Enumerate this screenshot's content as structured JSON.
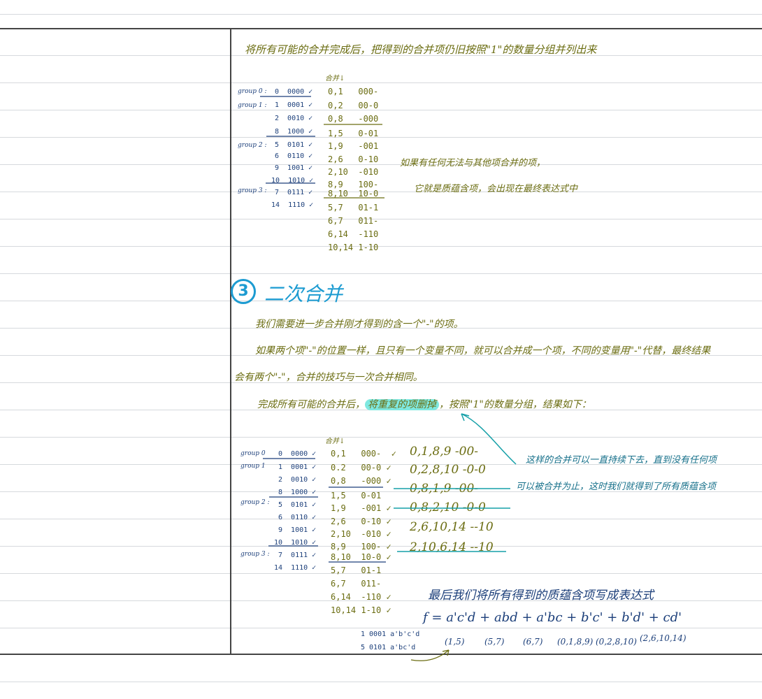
{
  "section1": {
    "intro": "将所有可能的合并完成后，把得到的合并项仍旧按照\"1\"的数量分组并列出来",
    "table_header": "合并↓",
    "group_labels": [
      "group 0 :",
      "group 1 :",
      "group 2 :",
      "group 3 :"
    ],
    "minterms": [
      "0  0000 ✓",
      "1  0001 ✓",
      "2  0010 ✓",
      "8  1000 ✓",
      "5  0101 ✓",
      "6  0110 ✓",
      "9  1001 ✓",
      "10  1010 ✓",
      "7  0111 ✓",
      "14  1110 ✓"
    ],
    "merged": [
      "0,1   000-",
      "0,2   00-0",
      "0,8   -000",
      "1,5   0-01",
      "1,9   -001",
      "2,6   0-10",
      "2,10  -010",
      "8,9   100-",
      "8,10  10-0",
      "5,7   01-1",
      "6,7   011-",
      "6,14  -110",
      "10,14 1-10"
    ],
    "note_line1": "如果有任何无法与其他项合并的项，",
    "note_line2": "它就是质蕴含项，会出现在最终表达式中"
  },
  "section2": {
    "number": "3",
    "title": "二次合并",
    "para1": "我们需要进一步合并刚才得到的含一个\"-\"的项。",
    "para2a": "如果两个项\"-\"的位置一样，且只有一个变量不同，就可以合并成一个项，不同的变量用\"-\"代替，最终结果",
    "para2b": "会有两个\"-\"，合并的技巧与一次合并相同。",
    "para3_pre": "完成所有可能的合并后，",
    "para3_highlight": "将重复的项删掉",
    "para3_post": "，按照\"1\"的数量分组，结果如下：",
    "table_header": "合并↓",
    "group_labels": [
      "group 0",
      "group 1",
      "group 2 :",
      "group 3 :"
    ],
    "minterms": [
      "0  0000 ✓",
      "1  0001 ✓",
      "2  0010 ✓",
      "8  1000 ✓",
      "5  0101 ✓",
      "6  0110 ✓",
      "9  1001 ✓",
      "10  1010 ✓",
      "7  0111 ✓",
      "14  1110 ✓"
    ],
    "merged": [
      "0,1   000-  ✓",
      "0.2   00-0 ✓",
      "0,8   -000 ✓",
      "1,5   0-01",
      "1,9   -001 ✓",
      "2,6   0-10 ✓",
      "2,10  -010 ✓",
      "8,9   100- ✓",
      "8,10  10-0 ✓",
      "5,7   01-1",
      "6,7   011-",
      "6,14  -110 ✓",
      "10,14 1-10 ✓"
    ],
    "second_merge": [
      "0,1,8,9  -00-",
      "0,2,8,10  -0-0",
      "0,8,1,9  -00-",
      "0,8,2,10  -0-0",
      "2,6,10,14  --10",
      "2,10,6,14  --10"
    ],
    "note_line1": "这样的合并可以一直持续下去，直到没有任何项",
    "note_line2": "可以被合并为止，这时我们就得到了所有质蕴含项",
    "final_title": "最后我们将所有得到的质蕴含项写成表达式",
    "expression": "f = a'c'd + abd + a'bc + b'c' + b'd' + cd'",
    "groups_under": [
      "(1,5)",
      "(5,7)",
      "(6,7)",
      "(0,1,8,9)",
      "(0,2,8,10)",
      "(2,6,10,14)"
    ],
    "side_work1": "1 0001 a'b'c'd",
    "side_work2": "5 0101 a'bc'd"
  },
  "colors": {
    "olive": "#6b6d12",
    "navy": "#1c3f7a",
    "teal": "#16708a",
    "highlight": "#7fe8e0",
    "rule": "#d6d9dd"
  }
}
